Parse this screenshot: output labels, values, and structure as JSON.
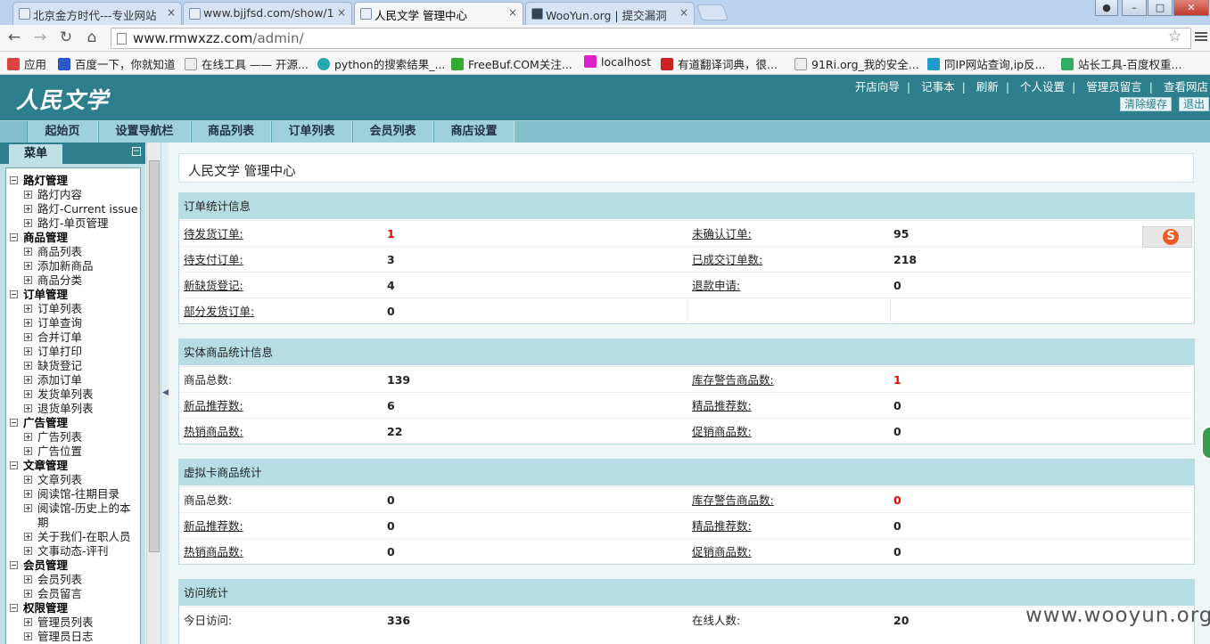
{
  "browser": {
    "tabs": [
      {
        "title": "北京金方时代---专业网站",
        "active": false
      },
      {
        "title": "www.bjjfsd.com/show/1",
        "active": false
      },
      {
        "title": "人民文学 管理中心",
        "active": true
      },
      {
        "title": "WooYun.org | 提交漏洞",
        "active": false
      }
    ],
    "tab_close": "×",
    "url_host": "www.rmwxzz.com",
    "url_path": "/admin/",
    "bookmarks": [
      {
        "label": "应用",
        "icon": "apps-grid-icon",
        "color": "#d44"
      },
      {
        "label": "百度一下，你就知道",
        "icon": "baidu-paw-icon",
        "color": "#2b58c8"
      },
      {
        "label": "在线工具 —— 开源...",
        "icon": "page-icon",
        "color": "#ddd"
      },
      {
        "label": "python的搜索结果_...",
        "icon": "play-circle-icon",
        "color": "#2aa"
      },
      {
        "label": "FreeBuf.COM关注...",
        "icon": "freebuf-icon",
        "color": "#3a3"
      },
      {
        "label": "localhost",
        "icon": "localhost-icon",
        "color": "#d2c"
      },
      {
        "label": "有道翻译词典，很...",
        "icon": "youdao-icon",
        "color": "#c22"
      },
      {
        "label": "91Ri.org_我的安全...",
        "icon": "page-icon",
        "color": "#ddd"
      },
      {
        "label": "同IP网站查询,ip反...",
        "icon": "phone-icon",
        "color": "#29c"
      },
      {
        "label": "站长工具-百度权重...",
        "icon": "chinaz-icon",
        "color": "#3a6"
      }
    ]
  },
  "app": {
    "logo": "人民文学",
    "toplinks": [
      "开店向导",
      "记事本",
      "刷新",
      "个人设置",
      "管理员留言",
      "查看网店"
    ],
    "clear_cache": "清除缓存",
    "logout": "退出",
    "nav": [
      "起始页",
      "设置导航栏",
      "商品列表",
      "订单列表",
      "会员列表",
      "商店设置"
    ],
    "menu_title": "菜单",
    "menu_collapse": "−",
    "menu": [
      {
        "group": "路灯管理",
        "items": [
          "路灯内容",
          "路灯-Current issue",
          "路灯-单页管理"
        ]
      },
      {
        "group": "商品管理",
        "items": [
          "商品列表",
          "添加新商品",
          "商品分类"
        ]
      },
      {
        "group": "订单管理",
        "items": [
          "订单列表",
          "订单查询",
          "合并订单",
          "订单打印",
          "缺货登记",
          "添加订单",
          "发货单列表",
          "退货单列表"
        ]
      },
      {
        "group": "广告管理",
        "items": [
          "广告列表",
          "广告位置"
        ]
      },
      {
        "group": "文章管理",
        "items": [
          "文章列表",
          "阅读馆-往期目录",
          "阅读馆-历史上的本",
          "期",
          "关于我们-在职人员",
          "文事动态-评刊"
        ]
      },
      {
        "group": "会员管理",
        "items": [
          "会员列表",
          "会员留言"
        ]
      },
      {
        "group": "权限管理",
        "items": [
          "管理员列表",
          "管理员日志"
        ]
      }
    ]
  },
  "main": {
    "title": "人民文学 管理中心",
    "panels": [
      {
        "heading": "订单统计信息",
        "rows": [
          [
            {
              "label": "待发货订单:",
              "value": "1",
              "red": true
            },
            {
              "label": "未确认订单:",
              "value": "95"
            }
          ],
          [
            {
              "label": "待支付订单:",
              "value": "3"
            },
            {
              "label": "已成交订单数:",
              "value": "218"
            }
          ],
          [
            {
              "label": "新缺货登记:",
              "value": "4"
            },
            {
              "label": "退款申请:",
              "value": "0"
            }
          ],
          [
            {
              "label": "部分发货订单:",
              "value": "0"
            },
            {
              "label": "",
              "value": ""
            }
          ]
        ]
      },
      {
        "heading": "实体商品统计信息",
        "rows": [
          [
            {
              "label": "商品总数:",
              "value": "139",
              "plain": true
            },
            {
              "label": "库存警告商品数:",
              "value": "1",
              "red": true
            }
          ],
          [
            {
              "label": "新品推荐数:",
              "value": "6"
            },
            {
              "label": "精品推荐数:",
              "value": "0"
            }
          ],
          [
            {
              "label": "热销商品数:",
              "value": "22"
            },
            {
              "label": "促销商品数:",
              "value": "0"
            }
          ]
        ]
      },
      {
        "heading": "虚拟卡商品统计",
        "rows": [
          [
            {
              "label": "商品总数:",
              "value": "0",
              "plain": true
            },
            {
              "label": "库存警告商品数:",
              "value": "0",
              "red": true
            }
          ],
          [
            {
              "label": "新品推荐数:",
              "value": "0"
            },
            {
              "label": "精品推荐数:",
              "value": "0"
            }
          ],
          [
            {
              "label": "热销商品数:",
              "value": "0"
            },
            {
              "label": "促销商品数:",
              "value": "0"
            }
          ]
        ]
      },
      {
        "heading": "访问统计",
        "rows": [
          [
            {
              "label": "今日访问:",
              "value": "336",
              "plain": true
            },
            {
              "label": "在线人数:",
              "value": "20",
              "plain": true
            }
          ]
        ]
      }
    ],
    "watermark": "www.wooyun.org"
  }
}
